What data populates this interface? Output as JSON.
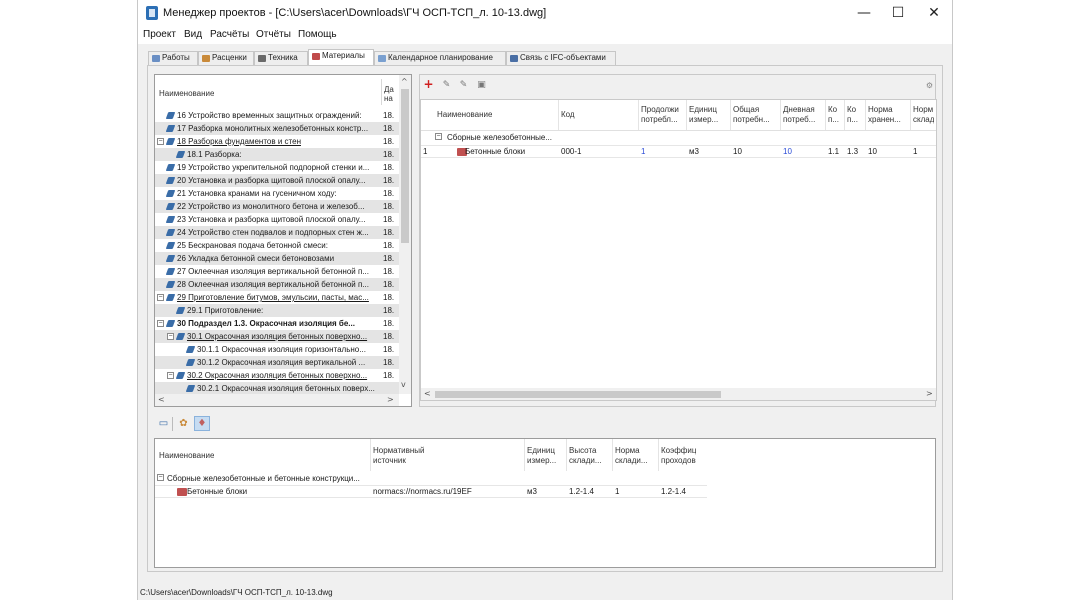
{
  "window": {
    "title": "Менеджер проектов - [C:\\Users\\acer\\Downloads\\ГЧ ОСП-ТСП_л. 10-13.dwg]",
    "minimize_icon": "minimize-icon",
    "maximize_icon": "maximize-icon",
    "close_icon": "close-icon"
  },
  "menu": [
    "Проект",
    "Вид",
    "Расчёты",
    "Отчёты",
    "Помощь"
  ],
  "tabs": [
    {
      "label": "Работы",
      "icon": "works-icon",
      "color": "#6a8fc4"
    },
    {
      "label": "Расценки",
      "icon": "rates-icon",
      "color": "#c98a3a"
    },
    {
      "label": "Техника",
      "icon": "machinery-icon",
      "color": "#6a6a6a"
    },
    {
      "label": "Материалы",
      "icon": "materials-icon",
      "color": "#c04a4a"
    },
    {
      "label": "Календарное планирование",
      "icon": "calendar-icon",
      "color": "#7aa0d0"
    },
    {
      "label": "Связь с IFC-объектами",
      "icon": "ifc-link-icon",
      "color": "#4a6fa5"
    }
  ],
  "tree": {
    "headers": {
      "name": "Наименование",
      "date_line1": "Да",
      "date_line2": "на"
    },
    "rows": [
      {
        "label": "16 Устройство временных защитных ограждений:",
        "value": "18.",
        "shade": false
      },
      {
        "label": "17 Разборка монолитных железобетонных констр...",
        "value": "18.",
        "shade": true
      },
      {
        "label": "18 Разборка фундаментов и стен",
        "value": "18.",
        "shade": false,
        "expander": "⊟"
      },
      {
        "label": "18.1 Разборка:",
        "value": "18.",
        "shade": true
      },
      {
        "label": "19 Устройство укрепительной подпорной стенки и...",
        "value": "18.",
        "shade": false
      },
      {
        "label": "20 Установка и разборка щитовой плоской опалу...",
        "value": "18.",
        "shade": true
      },
      {
        "label": "21 Установка кранами на гусеничном ходу:",
        "value": "18.",
        "shade": false
      },
      {
        "label": "22 Устройство из монолитного бетона и железоб...",
        "value": "18.",
        "shade": true
      },
      {
        "label": "23 Установка и разборка щитовой плоской опалу...",
        "value": "18.",
        "shade": false
      },
      {
        "label": "24 Устройство стен подвалов и подпорных стен ж...",
        "value": "18.",
        "shade": true
      },
      {
        "label": "25 Бескрановая подача бетонной смеси:",
        "value": "18.",
        "shade": false
      },
      {
        "label": "26 Укладка бетонной смеси бетоновозами",
        "value": "18.",
        "shade": true
      },
      {
        "label": "27 Оклеечная изоляция вертикальной бетонной п...",
        "value": "18.",
        "shade": false
      },
      {
        "label": "28 Оклеечная изоляция вертикальной бетонной п...",
        "value": "18.",
        "shade": true
      },
      {
        "label": "29 Приготовление битумов, эмульсии, пасты, мас...",
        "value": "18.",
        "shade": false,
        "expander": "⊟"
      },
      {
        "label": "29.1 Приготовление:",
        "value": "18.",
        "shade": true
      },
      {
        "label": "30 Подраздел 1.3. Окрасочная изоляция бе...",
        "value": "18.",
        "shade": false,
        "expander": "⊟",
        "bold": true
      },
      {
        "label": "30.1 Окрасочная изоляция бетонных поверхно...",
        "value": "18.",
        "shade": true,
        "expander": "⊟"
      },
      {
        "label": "30.1.1 Окрасочная изоляция горизонтально...",
        "value": "18.",
        "shade": false
      },
      {
        "label": "30.1.2 Окрасочная изоляция вертикальной ...",
        "value": "18.",
        "shade": true
      },
      {
        "label": "30.2 Окрасочная изоляция бетонных поверхно...",
        "value": "18.",
        "shade": false,
        "expander": "⊟"
      },
      {
        "label": "30.2.1 Окрасочная изоляция бетонных поверх...",
        "value": "",
        "shade": true
      }
    ]
  },
  "materials_grid": {
    "toolbar": [
      "add-icon",
      "edit-icon",
      "copy-icon",
      "delete-icon"
    ],
    "right_toolbar_icon": "settings-icon",
    "headers": [
      {
        "line1": "Наименование",
        "line2": ""
      },
      {
        "line1": "Код",
        "line2": ""
      },
      {
        "line1": "Продолжи",
        "line2": "потребл..."
      },
      {
        "line1": "Единиц",
        "line2": "измер..."
      },
      {
        "line1": "Общая",
        "line2": "потребн..."
      },
      {
        "line1": "Дневная",
        "line2": "потреб..."
      },
      {
        "line1": "Ко",
        "line2": "п..."
      },
      {
        "line1": "Ко",
        "line2": "п..."
      },
      {
        "line1": "Норма",
        "line2": "хранен..."
      },
      {
        "line1": "Норм",
        "line2": "склад"
      }
    ],
    "group": "Сборные железобетонные...",
    "row": {
      "num": "1",
      "name": "Бетонные блоки",
      "code": "000-1",
      "duration": "1",
      "unit": "м3",
      "total": "10",
      "daily": "10",
      "k1": "1.1",
      "k2": "1.3",
      "storage_norm": "10",
      "warehouse_norm": "1"
    }
  },
  "bottom_toolbar": [
    "table-icon",
    "paint-icon",
    "storage-icon"
  ],
  "storage_grid": {
    "headers": [
      {
        "line1": "Наименование",
        "line2": ""
      },
      {
        "line1": "Нормативный",
        "line2": "источник"
      },
      {
        "line1": "Единиц",
        "line2": "измер..."
      },
      {
        "line1": "Высота",
        "line2": "склади..."
      },
      {
        "line1": "Норма",
        "line2": "склади..."
      },
      {
        "line1": "Коэффиц",
        "line2": "проходов"
      }
    ],
    "group": "Сборные железобетонные и бетонные конструкци...",
    "row": {
      "name": "Бетонные блоки",
      "source": "normacs://normacs.ru/19EF",
      "unit": "м3",
      "height": "1.2-1.4",
      "norm": "1",
      "coef": "1.2-1.4"
    }
  },
  "status": "C:\\Users\\acer\\Downloads\\ГЧ ОСП-ТСП_л. 10-13.dwg"
}
